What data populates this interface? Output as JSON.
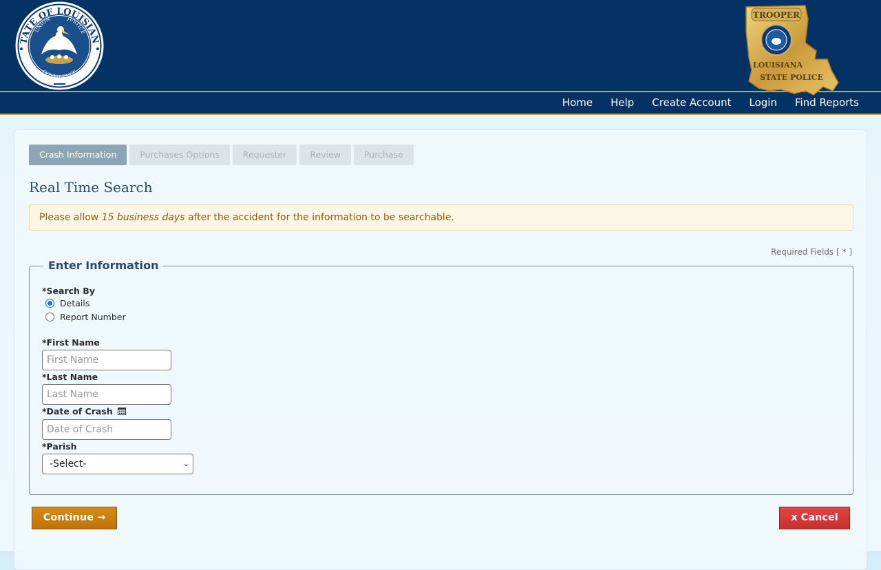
{
  "header": {
    "nav": [
      "Home",
      "Help",
      "Create Account",
      "Login",
      "Find Reports"
    ],
    "seal": {
      "ring_text_top": "STATE OF LOUISIANA",
      "motto_left": "UNION",
      "motto_right": "JUSTICE",
      "motto_bottom": "CONFIDENCE"
    },
    "badge": {
      "top_text": "TROOPER",
      "mid_text": "LOUISIANA",
      "bottom_text": "STATE POLICE"
    },
    "colors": {
      "navy": "#043265",
      "gold": "#c8a838"
    }
  },
  "steps": [
    {
      "label": "Crash Information",
      "active": true
    },
    {
      "label": "Purchases Options",
      "active": false
    },
    {
      "label": "Requester",
      "active": false
    },
    {
      "label": "Review",
      "active": false
    },
    {
      "label": "Purchase",
      "active": false
    }
  ],
  "page_title": "Real Time Search",
  "alert": {
    "prefix": "Please allow ",
    "emphasis": "15 business days",
    "suffix": " after the accident for the information to be searchable."
  },
  "required_note": "Required Fields [ * ]",
  "form": {
    "legend": "Enter Information",
    "search_by_label": "*Search By",
    "search_options": [
      {
        "label": "Details",
        "checked": true
      },
      {
        "label": "Report Number",
        "checked": false
      }
    ],
    "first_name": {
      "label": "*First Name",
      "placeholder": "First Name"
    },
    "last_name": {
      "label": "*Last Name",
      "placeholder": "Last Name"
    },
    "date_of_crash": {
      "label": "*Date of Crash",
      "placeholder": "Date of Crash"
    },
    "parish": {
      "label": "*Parish",
      "value": "-Select-"
    }
  },
  "buttons": {
    "continue": "Continue →",
    "cancel": "x Cancel"
  }
}
